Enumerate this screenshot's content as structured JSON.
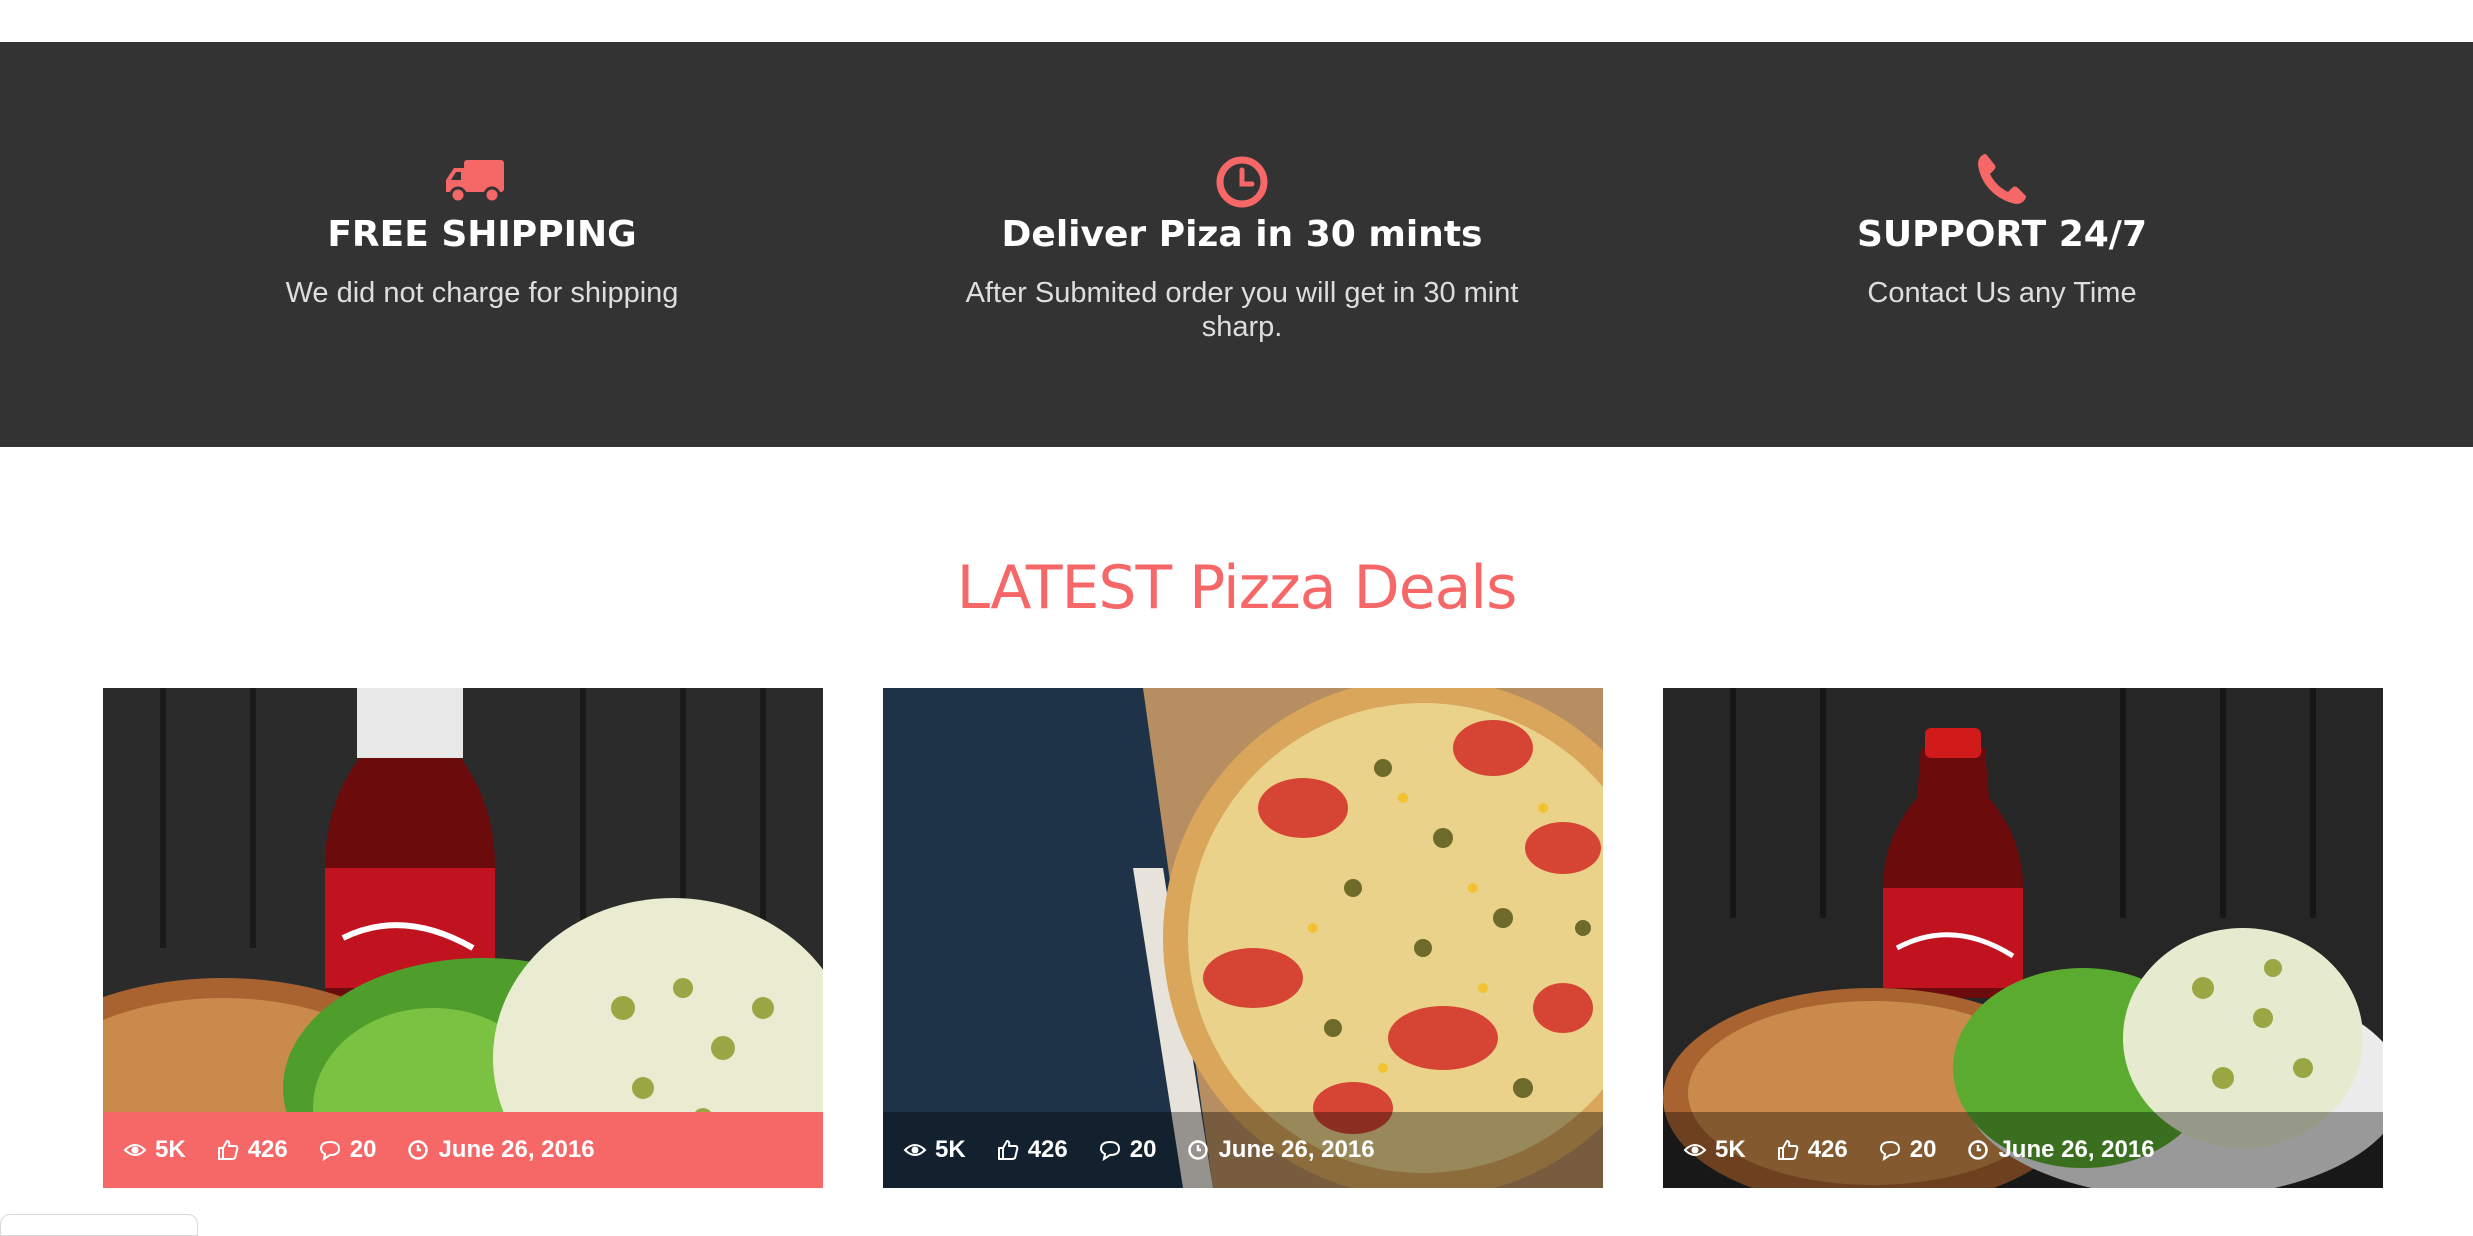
{
  "colors": {
    "accent": "#f66768",
    "band": "#333333"
  },
  "features": [
    {
      "icon": "truck-icon",
      "title": "FREE SHIPPING",
      "text": "We did not charge for shipping"
    },
    {
      "icon": "clock-icon",
      "title": "Deliver Piza in 30 mints",
      "text": "After Submited order you will get in 30 mint sharp."
    },
    {
      "icon": "phone-icon",
      "title": "SUPPORT 24/7",
      "text": "Contact Us any Time"
    }
  ],
  "section": {
    "title": "LATEST Pizza Deals"
  },
  "deals": [
    {
      "image": "coca-cola-pizza-combo",
      "views": "5K",
      "likes": "426",
      "comments": "20",
      "date": "June 26, 2016"
    },
    {
      "image": "pizza-in-box",
      "views": "5K",
      "likes": "426",
      "comments": "20",
      "date": "June 26, 2016"
    },
    {
      "image": "coca-cola-pizza-combo",
      "views": "5K",
      "likes": "426",
      "comments": "20",
      "date": "June 26, 2016"
    }
  ]
}
